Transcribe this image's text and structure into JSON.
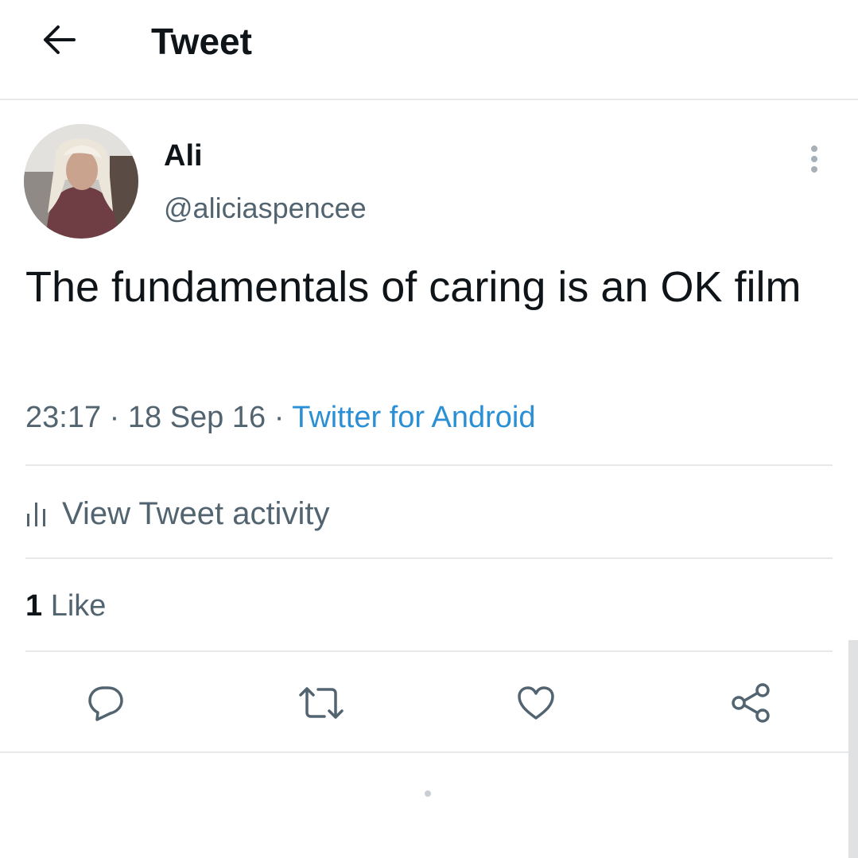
{
  "header": {
    "title": "Tweet",
    "back_icon": "arrow-left-icon"
  },
  "author": {
    "name": "Ali",
    "handle": "@aliciaspencee",
    "avatar": "profile-photo"
  },
  "more_icon": "more-vertical-icon",
  "tweet": {
    "text": "The fundamentals of caring is an OK film"
  },
  "meta": {
    "time": "23:17",
    "separator": "·",
    "date": "18 Sep 16",
    "source": "Twitter for Android"
  },
  "activity": {
    "label": "View Tweet activity",
    "icon": "bar-chart-icon"
  },
  "likes": {
    "count": "1",
    "label": "Like"
  },
  "actions": [
    {
      "name": "reply",
      "icon": "reply-icon"
    },
    {
      "name": "retweet",
      "icon": "retweet-icon"
    },
    {
      "name": "like",
      "icon": "heart-icon"
    },
    {
      "name": "share",
      "icon": "share-icon"
    }
  ],
  "colors": {
    "text": "#0f1419",
    "secondary": "#536471",
    "link": "#2a8fd4",
    "divider": "#e6e8ea"
  }
}
